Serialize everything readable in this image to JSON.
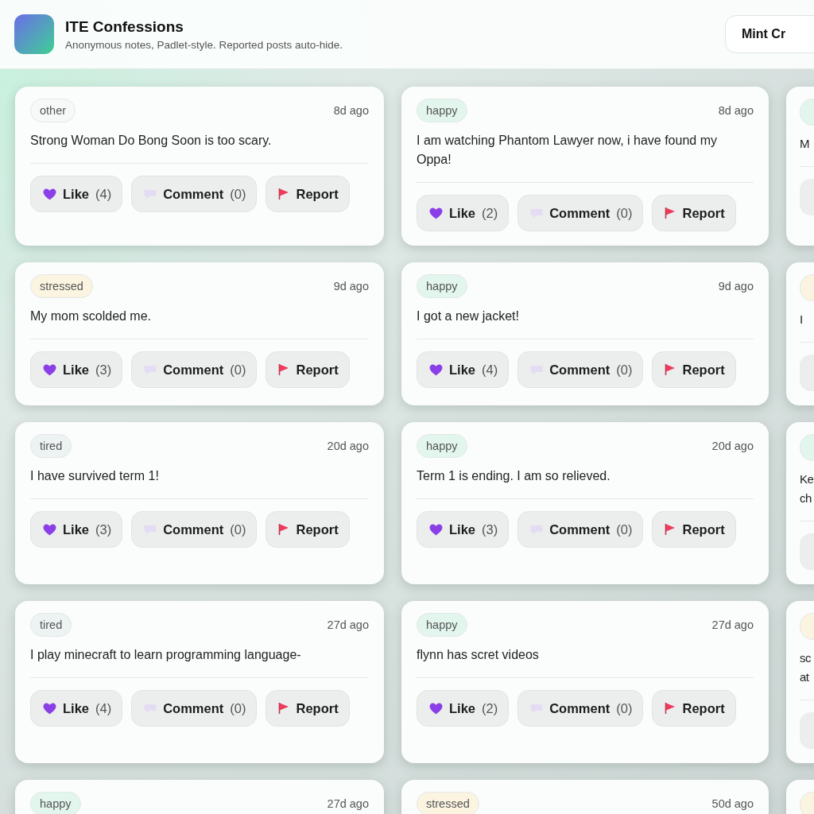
{
  "header": {
    "title": "ITE Confessions",
    "subtitle": "Anonymous notes, Padlet-style. Reported posts auto-hide.",
    "theme_button": "Mint Cr"
  },
  "cards": [
    {
      "kind": "full",
      "mood": "other",
      "color": "#f7f9f9",
      "time": "8d ago",
      "text": "Strong Woman Do Bong Soon is too scary.",
      "like": "Like",
      "likes": "(4)",
      "comment": "Comment",
      "comments": "(0)",
      "report": "Report"
    },
    {
      "kind": "full",
      "mood": "happy",
      "color": "#e2f6ee",
      "time": "8d ago",
      "text": "I am watching Phantom Lawyer now, i have found my Oppa!",
      "like": "Like",
      "likes": "(2)",
      "comment": "Comment",
      "comments": "(0)",
      "report": "Report"
    },
    {
      "kind": "clipped",
      "color": "#e2f6ee",
      "lines": [
        "M"
      ]
    },
    {
      "kind": "full",
      "mood": "stressed",
      "color": "#fbf4e1",
      "time": "9d ago",
      "text": "My mom scolded me.",
      "like": "Like",
      "likes": "(3)",
      "comment": "Comment",
      "comments": "(0)",
      "report": "Report"
    },
    {
      "kind": "full",
      "mood": "happy",
      "color": "#e2f6ee",
      "time": "9d ago",
      "text": "I got a new jacket!",
      "like": "Like",
      "likes": "(4)",
      "comment": "Comment",
      "comments": "(0)",
      "report": "Report"
    },
    {
      "kind": "clipped",
      "color": "#fbf4e1",
      "lines": [
        "I"
      ]
    },
    {
      "kind": "full",
      "mood": "tired",
      "color": "#edf2f3",
      "time": "20d ago",
      "text": "I have survived term 1!",
      "like": "Like",
      "likes": "(3)",
      "comment": "Comment",
      "comments": "(0)",
      "report": "Report"
    },
    {
      "kind": "full",
      "mood": "happy",
      "color": "#e2f6ee",
      "time": "20d ago",
      "text": "Term 1 is ending. I am so relieved.",
      "like": "Like",
      "likes": "(3)",
      "comment": "Comment",
      "comments": "(0)",
      "report": "Report"
    },
    {
      "kind": "clipped",
      "color": "#e2f6ee",
      "lines": [
        "Ke",
        "ch"
      ]
    },
    {
      "kind": "full",
      "mood": "tired",
      "color": "#edf2f3",
      "time": "27d ago",
      "text": "I play minecraft to learn programming language-",
      "like": "Like",
      "likes": "(4)",
      "comment": "Comment",
      "comments": "(0)",
      "report": "Report"
    },
    {
      "kind": "full",
      "mood": "happy",
      "color": "#e2f6ee",
      "time": "27d ago",
      "text": "flynn has scret videos",
      "like": "Like",
      "likes": "(2)",
      "comment": "Comment",
      "comments": "(0)",
      "report": "Report"
    },
    {
      "kind": "clipped",
      "color": "#fbf4e1",
      "lines": [
        "sc",
        "at"
      ]
    },
    {
      "kind": "full",
      "mood": "happy",
      "color": "#e2f6ee",
      "time": "27d ago"
    },
    {
      "kind": "full",
      "mood": "stressed",
      "color": "#fbf4e1",
      "time": "50d ago"
    },
    {
      "kind": "clipped",
      "color": "#fbf4e1"
    }
  ]
}
